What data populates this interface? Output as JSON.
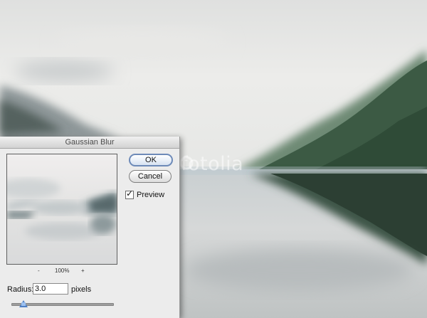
{
  "dialog": {
    "title": "Gaussian Blur",
    "ok_label": "OK",
    "cancel_label": "Cancel",
    "preview_label": "Preview",
    "preview_checked": true,
    "zoom_out": "-",
    "zoom_level": "100%",
    "zoom_in": "+",
    "radius_label": "Radius:",
    "radius_value": "3.0",
    "pixels_label": "pixels",
    "slider_position": 0.12
  },
  "background": {
    "watermark_text": "fotolia"
  }
}
